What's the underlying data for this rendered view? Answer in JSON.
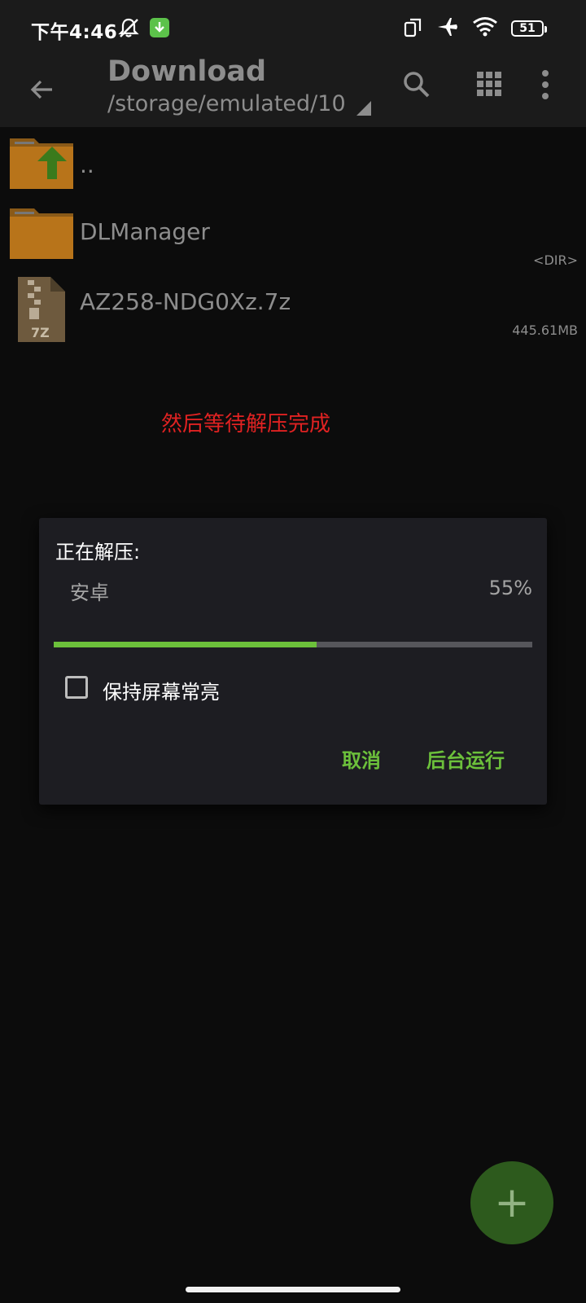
{
  "status_bar": {
    "time": "下午4:46",
    "battery": "51",
    "icons": [
      "mute-icon",
      "download-notification-icon",
      "screen-rotate-icon",
      "airplane-icon",
      "wifi-icon",
      "battery-icon"
    ]
  },
  "toolbar": {
    "title": "Download",
    "path": "/storage/emulated/10",
    "icons": [
      "back-arrow-icon",
      "search-icon",
      "grid-view-icon",
      "more-vert-icon"
    ]
  },
  "files": [
    {
      "name": "..",
      "meta": "",
      "icon": "parent-folder-icon"
    },
    {
      "name": "DLManager",
      "meta": "<DIR>",
      "icon": "folder-icon"
    },
    {
      "name": "AZ258-NDG0Xz.7z",
      "meta": "445.61MB",
      "icon": "7z-archive-icon"
    }
  ],
  "hint_text": "然后等待解压完成",
  "dialog": {
    "title": "正在解压:",
    "file": "安卓",
    "percent_label": "55%",
    "progress": 0.55,
    "keep_screen_on_label": "保持屏幕常亮",
    "keep_screen_on_checked": false,
    "cancel_label": "取消",
    "background_label": "后台运行"
  },
  "fab": {
    "label": "+"
  },
  "colors": {
    "accent": "#6cc03b",
    "hint": "#e02222",
    "folder": "#c27b1e",
    "fab": "#2d5a1d"
  }
}
